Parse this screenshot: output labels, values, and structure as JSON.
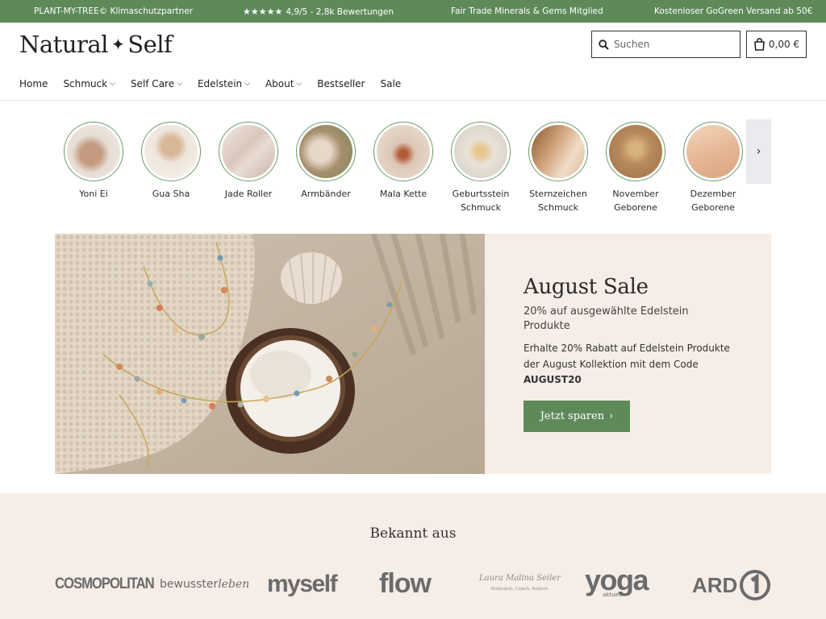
{
  "topbar": {
    "items": [
      "PLANT-MY-TREE© Klimaschutzpartner",
      "4,9/5 - 2,8k Bewertungen",
      "Fair Trade Minerals & Gems Mitglied",
      "Kostenloser GoGreen Versand ab 50€"
    ],
    "stars": "★★★★★"
  },
  "header": {
    "logo_left": "Natural",
    "logo_right": "Self",
    "search_placeholder": "Suchen",
    "cart_total": "0,00 €"
  },
  "nav": [
    {
      "label": "Home",
      "dropdown": false
    },
    {
      "label": "Schmuck",
      "dropdown": true
    },
    {
      "label": "Self Care",
      "dropdown": true
    },
    {
      "label": "Edelstein",
      "dropdown": true
    },
    {
      "label": "About",
      "dropdown": true
    },
    {
      "label": "Bestseller",
      "dropdown": false
    },
    {
      "label": "Sale",
      "dropdown": false
    }
  ],
  "categories": [
    {
      "line1": "Yoni Ei",
      "line2": "",
      "color": "#d9cfc6"
    },
    {
      "line1": "Gua Sha",
      "line2": "",
      "color": "#ece4da"
    },
    {
      "line1": "Jade Roller",
      "line2": "",
      "color": "#dcd1ca"
    },
    {
      "line1": "Armbänder",
      "line2": "",
      "color": "#a99a7e"
    },
    {
      "line1": "Mala Kette",
      "line2": "",
      "color": "#d7c4b2"
    },
    {
      "line1": "Geburtsstein",
      "line2": "Schmuck",
      "color": "#e6e0d6"
    },
    {
      "line1": "Sternzeichen",
      "line2": "Schmuck",
      "color": "#c79f74"
    },
    {
      "line1": "November",
      "line2": "Geborene",
      "color": "#b88b5f"
    },
    {
      "line1": "Dezember",
      "line2": "Geborene",
      "color": "#e8c2a0"
    }
  ],
  "banner": {
    "title": "August Sale",
    "subtitle": "20% auf ausgewählte Edelstein Produkte",
    "body": "Erhalte 20% Rabatt auf Edelstein Produkte der August Kollektion mit dem Code",
    "code": "AUGUST20",
    "button": "Jetzt sparen",
    "accent": "#5e8a5a"
  },
  "press": {
    "title": "Bekannt aus",
    "logos": [
      "COSMOPOLITAN",
      "bewusster",
      "leben",
      "myself",
      "flow",
      "Laura Malina Seiler",
      "Visionärin, Coach, Autorin",
      "yoga",
      "aktuell",
      "ARD"
    ]
  }
}
